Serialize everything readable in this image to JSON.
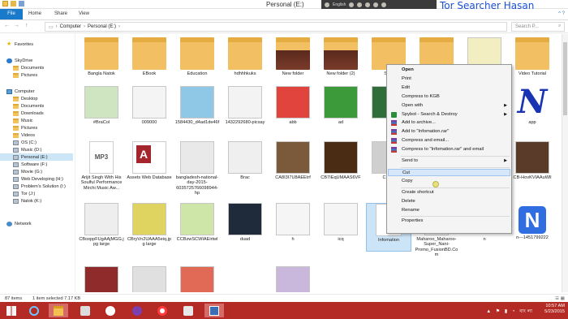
{
  "window": {
    "title": "Personal (E:)",
    "brand_overlay": "Tor Searcher Hasan",
    "recorder_text": "English"
  },
  "ribbon": {
    "tabs": [
      "File",
      "Home",
      "Share",
      "View"
    ],
    "help_glyph": "^ ?"
  },
  "address": {
    "back": "←",
    "forward": "→",
    "up": "↑",
    "path": [
      "Computer",
      "Personal (E:)"
    ],
    "search_placeholder": "Search P..."
  },
  "nav": {
    "items": [
      {
        "label": "Favorites",
        "icon": "star-icon",
        "indent": 0
      },
      {
        "label": "SkyDrive",
        "icon": "cloud-icon",
        "indent": 0
      },
      {
        "label": "Documents",
        "icon": "folder-icon",
        "indent": 1
      },
      {
        "label": "Pictures",
        "icon": "folder-icon",
        "indent": 1
      },
      {
        "label": "Computer",
        "icon": "computer-icon",
        "indent": 0
      },
      {
        "label": "Desktop",
        "icon": "folder-icon",
        "indent": 1
      },
      {
        "label": "Documents",
        "icon": "folder-icon",
        "indent": 1
      },
      {
        "label": "Downloads",
        "icon": "folder-icon",
        "indent": 1
      },
      {
        "label": "Music",
        "icon": "folder-icon",
        "indent": 1
      },
      {
        "label": "Pictures",
        "icon": "folder-icon",
        "indent": 1
      },
      {
        "label": "Videos",
        "icon": "folder-icon",
        "indent": 1
      },
      {
        "label": "OS (C:)",
        "icon": "drive-icon",
        "indent": 1
      },
      {
        "label": "Music (D:)",
        "icon": "drive-icon",
        "indent": 1
      },
      {
        "label": "Personal (E:)",
        "icon": "drive-icon",
        "indent": 1,
        "selected": true
      },
      {
        "label": "Software (F:)",
        "icon": "drive-icon",
        "indent": 1
      },
      {
        "label": "Movie (G:)",
        "icon": "drive-icon",
        "indent": 1
      },
      {
        "label": "Web Developing (H:)",
        "icon": "drive-icon",
        "indent": 1
      },
      {
        "label": "Problem's Solution (I:)",
        "icon": "drive-icon",
        "indent": 1
      },
      {
        "label": "Tor (J:)",
        "icon": "drive-icon",
        "indent": 1
      },
      {
        "label": "Natok (K:)",
        "icon": "drive-icon",
        "indent": 1
      },
      {
        "label": "Network",
        "icon": "network-icon",
        "indent": 0
      }
    ]
  },
  "files": [
    {
      "label": "Bangla Natok",
      "kind": "folder"
    },
    {
      "label": "EBook",
      "kind": "folder"
    },
    {
      "label": "Education",
      "kind": "folder"
    },
    {
      "label": "hdhhhkuks",
      "kind": "folder"
    },
    {
      "label": "New folder",
      "kind": "folder-dark"
    },
    {
      "label": "New folder (2)",
      "kind": "folder-dark"
    },
    {
      "label": "Scre",
      "kind": "folder"
    },
    {
      "label": "",
      "kind": "folder"
    },
    {
      "label": "",
      "kind": "image",
      "color": "#f2eec2"
    },
    {
      "label": "Video Tutorial",
      "kind": "folder"
    },
    {
      "label": "#BraCol",
      "kind": "image",
      "color": "#cfe4c0"
    },
    {
      "label": "009000",
      "kind": "image",
      "color": "#f4f4f4"
    },
    {
      "label": "1584430_d4ad1de46f",
      "kind": "image",
      "color": "#8fc7e6"
    },
    {
      "label": "1432292680-picsay",
      "kind": "image",
      "color": "#f3f3f3"
    },
    {
      "label": "abb",
      "kind": "image",
      "color": "#e0443c"
    },
    {
      "label": "ad",
      "kind": "image",
      "color": "#3d9a3a"
    },
    {
      "label": "",
      "kind": "image",
      "color": "#2f6e3a"
    },
    {
      "label": "",
      "kind": "blank"
    },
    {
      "label": "",
      "kind": "blank"
    },
    {
      "label": "app",
      "kind": "icon-n"
    },
    {
      "label": "Arijit Singh With His Soulful Performance Mirchi Music Aw...",
      "kind": "mp3"
    },
    {
      "label": "Assets Web Database",
      "kind": "access"
    },
    {
      "label": "bangladesh-national-day-2015-6035725766098944-hp",
      "kind": "image",
      "color": "#e9e9e9"
    },
    {
      "label": "Brac",
      "kind": "image",
      "color": "#efefef"
    },
    {
      "label": "CA8I3I7U8AEEtrf",
      "kind": "image",
      "color": "#7a5a3a"
    },
    {
      "label": "CB7IEqUMAAS6VF",
      "kind": "image",
      "color": "#4a2b14"
    },
    {
      "label": "CBbjk",
      "kind": "image",
      "color": "#cfcfcf"
    },
    {
      "label": "",
      "kind": "blank"
    },
    {
      "label": "",
      "kind": "blank"
    },
    {
      "label": "CB-HovKVIAAuWll",
      "kind": "image",
      "color": "#5a3b2a"
    },
    {
      "label": "CBoxppFUgAAjMGG.jpg large",
      "kind": "image",
      "color": "#eeeeee"
    },
    {
      "label": "CBryVn2UAAA5eiq.jpg large",
      "kind": "image",
      "color": "#e0d460"
    },
    {
      "label": "CCBzwSCWIAEirtwl",
      "kind": "image",
      "color": "#cfe6a9"
    },
    {
      "label": "duad",
      "kind": "image",
      "color": "#1f2a3a"
    },
    {
      "label": "h",
      "kind": "image",
      "color": "#f5f5f5"
    },
    {
      "label": "icq",
      "kind": "image",
      "color": "#f5f5f5"
    },
    {
      "label": "Infomation",
      "kind": "doc",
      "selected": true
    },
    {
      "label": "Maharoo_Maharoo-Super_Nani-Promo_FusionBD.Com",
      "kind": "mp3"
    },
    {
      "label": "n",
      "kind": "blank"
    },
    {
      "label": "n---1451799222",
      "kind": "app-n"
    },
    {
      "label": "",
      "kind": "image",
      "color": "#8f2b2b"
    },
    {
      "label": "",
      "kind": "image",
      "color": "#e0e0e0"
    },
    {
      "label": "",
      "kind": "image",
      "color": "#e06a55"
    },
    {
      "label": "",
      "kind": "blank"
    },
    {
      "label": "",
      "kind": "image",
      "color": "#c9b8dc"
    }
  ],
  "context_menu": {
    "items": [
      {
        "label": "Open",
        "bold": true
      },
      {
        "label": "Print"
      },
      {
        "label": "Edit"
      },
      {
        "label": "Compress to KGB"
      },
      {
        "label": "Open with",
        "submenu": true
      },
      {
        "label": "Spybot - Search & Destroy",
        "submenu": true,
        "icon": "spybot-icon"
      },
      {
        "label": "Add to archive...",
        "icon": "winrar-icon"
      },
      {
        "label": "Add to \"Infomation.rar\"",
        "icon": "winrar-icon"
      },
      {
        "label": "Compress and email...",
        "icon": "winrar-icon"
      },
      {
        "label": "Compress to \"Infomation.rar\" and email",
        "icon": "winrar-icon"
      },
      {
        "sep": true
      },
      {
        "label": "Send to",
        "submenu": true
      },
      {
        "sep": true
      },
      {
        "label": "Cut",
        "highlighted": true
      },
      {
        "label": "Copy"
      },
      {
        "sep": true
      },
      {
        "label": "Create shortcut"
      },
      {
        "label": "Delete"
      },
      {
        "label": "Rename"
      },
      {
        "sep": true
      },
      {
        "label": "Properties"
      }
    ]
  },
  "status": {
    "count": "87 items",
    "selection": "1 item selected  7.17 KB",
    "view_icons": "☰ ▦"
  },
  "taskbar": {
    "apps": [
      "start-icon",
      "internet-explorer-icon",
      "file-explorer-icon",
      "computer-icon",
      "panda-icon",
      "viber-icon",
      "opera-icon",
      "utility-icon",
      "screen-recorder-icon"
    ],
    "tray_icons": "▲ ⚑ ▮ ◔ বাংলা",
    "time": "10:57 AM",
    "date": "5/23/2015"
  },
  "colors": {
    "accent": "#1979ca",
    "taskbar": "#b42a24",
    "selection": "#cde6f7",
    "brand": "#1a4fd6"
  }
}
